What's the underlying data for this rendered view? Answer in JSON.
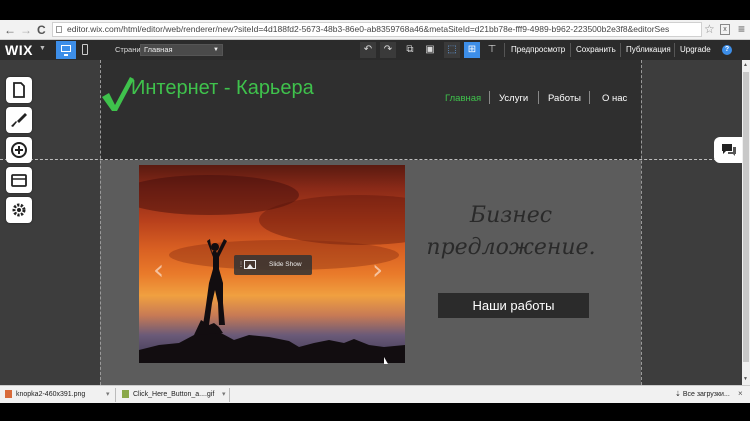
{
  "browser": {
    "url": "editor.wix.com/html/editor/web/renderer/new?siteId=4d188fd2-5673-48b3-86e0-ab8359768a46&metaSiteId=d21bb78e-fff9-4989-b962-223500b2e3f8&editorSes",
    "back_icon": "←",
    "forward_icon": "→",
    "reload_icon": "C",
    "star_icon": "☆",
    "menu_icon": "≡"
  },
  "wix_toolbar": {
    "logo": "WIX",
    "page_label": "Страница:",
    "page_value": "Главная",
    "undo_icon": "↶",
    "redo_icon": "↷",
    "links": [
      "Предпросмотр",
      "Сохранить",
      "Публикация",
      "Upgrade"
    ],
    "help": "?"
  },
  "site": {
    "title": "Интернет - Карьера",
    "brand_color": "#3fc24c",
    "menu": [
      "Главная",
      "Услуги",
      "Работы",
      "О нас"
    ],
    "active_menu": "Главная",
    "slideshow_label": "Slide Show",
    "slide_prev": "‹",
    "slide_next": "›",
    "headline_line1": "Бизнес",
    "headline_line2": "предложение.",
    "button_label": "Наши работы"
  },
  "left_panel": [
    "page-icon",
    "brush-icon",
    "add-icon",
    "media-icon",
    "settings-gear-icon"
  ],
  "downloads": {
    "items": [
      "knopka2-460x391.png",
      "Click_Here_Button_a....gif"
    ],
    "show_all": "Все загрузки...",
    "close": "×"
  }
}
